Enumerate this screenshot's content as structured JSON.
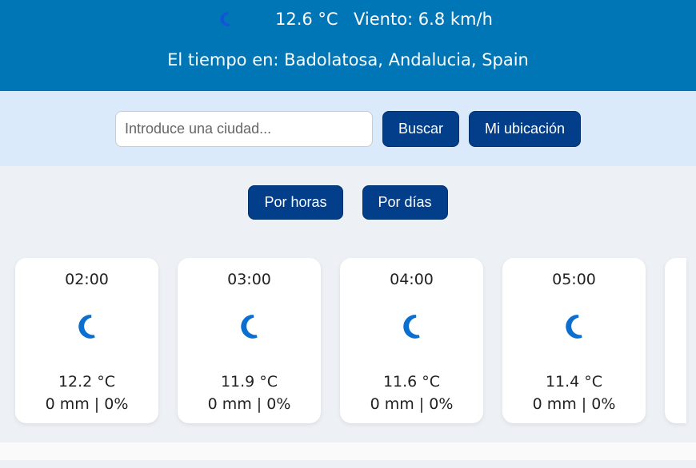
{
  "current": {
    "icon": "moon-icon",
    "temperature": "12.6 °C",
    "wind": "Viento: 6.8 km/h",
    "location": "El tiempo en: Badolatosa, Andalucia, Spain"
  },
  "search": {
    "placeholder": "Introduce una ciudad...",
    "value": "",
    "search_label": "Buscar",
    "location_label": "Mi ubicación"
  },
  "modes": {
    "hourly": "Por horas",
    "daily": "Por días"
  },
  "colors": {
    "header": "#0176b6",
    "button": "#023e8a",
    "icon": "#0a6fd0"
  },
  "hourly": [
    {
      "time": "02:00",
      "icon": "moon-icon",
      "temp": "12.2 °C",
      "precip": "0 mm | 0%"
    },
    {
      "time": "03:00",
      "icon": "moon-icon",
      "temp": "11.9 °C",
      "precip": "0 mm | 0%"
    },
    {
      "time": "04:00",
      "icon": "moon-icon",
      "temp": "11.6 °C",
      "precip": "0 mm | 0%"
    },
    {
      "time": "05:00",
      "icon": "moon-icon",
      "temp": "11.4 °C",
      "precip": "0 mm | 0%"
    }
  ]
}
